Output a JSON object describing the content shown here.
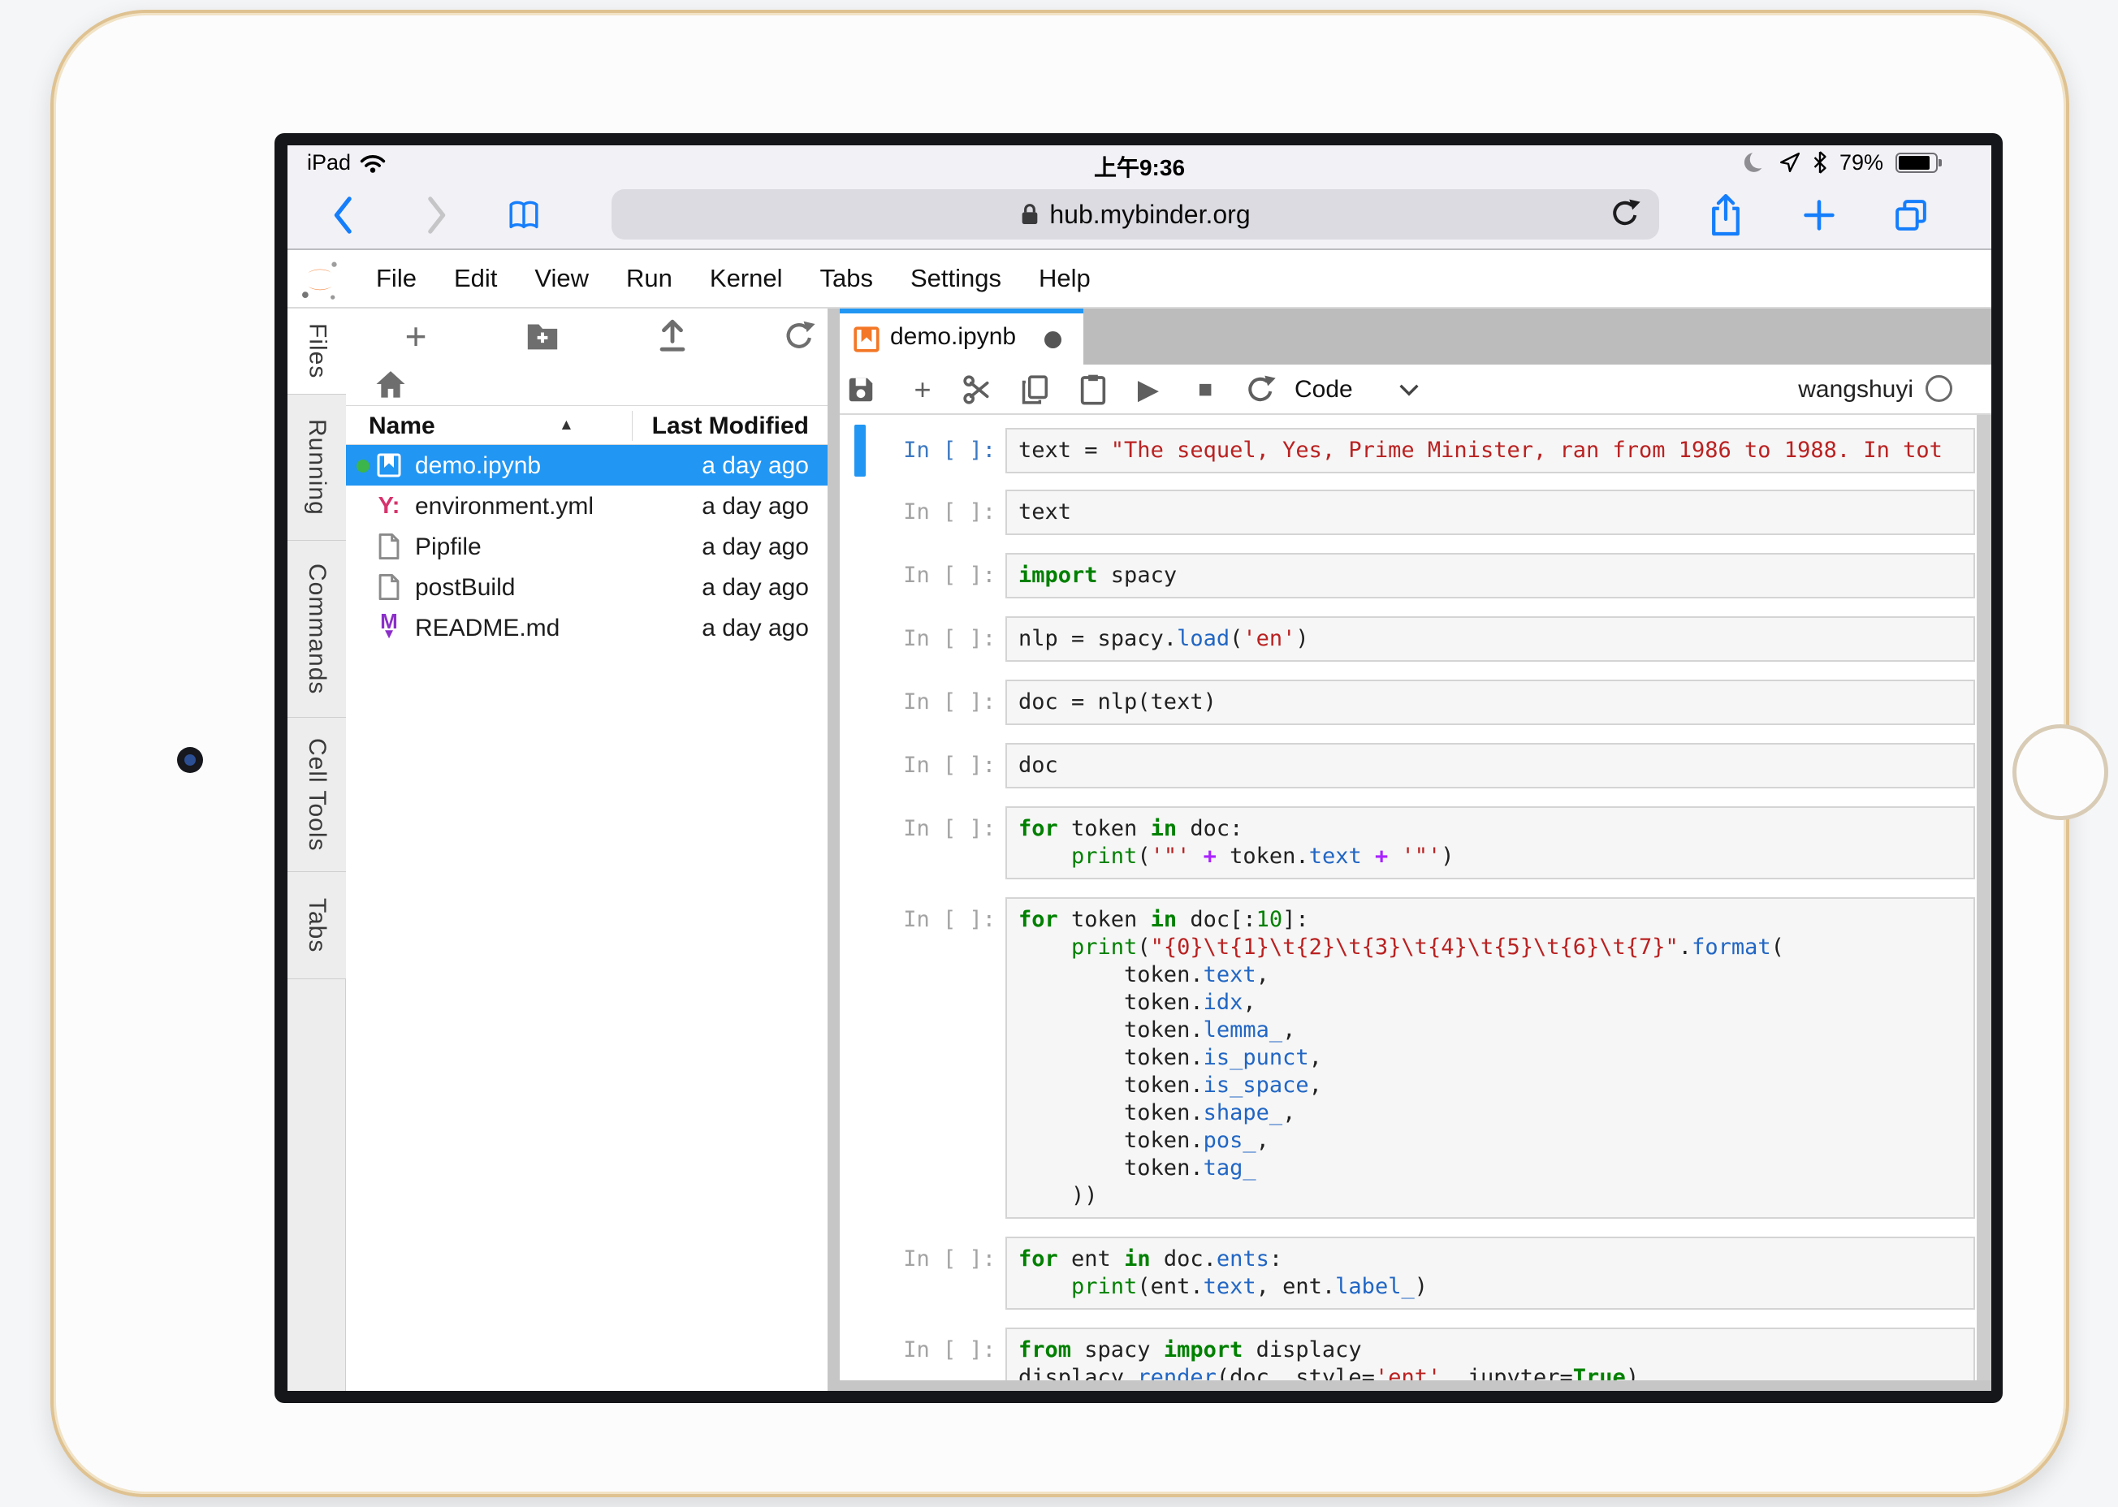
{
  "status_bar": {
    "carrier": "iPad",
    "time": "上午9:36",
    "battery_percent": "79%"
  },
  "browser": {
    "url": "hub.mybinder.org"
  },
  "jupyterlab": {
    "menu": [
      "File",
      "Edit",
      "View",
      "Run",
      "Kernel",
      "Tabs",
      "Settings",
      "Help"
    ],
    "sidebar_tabs": [
      {
        "label": "Files",
        "active": true
      },
      {
        "label": "Running",
        "active": false
      },
      {
        "label": "Commands",
        "active": false
      },
      {
        "label": "Cell Tools",
        "active": false
      },
      {
        "label": "Tabs",
        "active": false
      }
    ],
    "file_browser": {
      "columns": {
        "name": "Name",
        "modified": "Last Modified"
      },
      "files": [
        {
          "name": "demo.ipynb",
          "modified": "a day ago",
          "type": "notebook",
          "selected": true,
          "running": true
        },
        {
          "name": "environment.yml",
          "modified": "a day ago",
          "type": "yaml",
          "selected": false,
          "running": false
        },
        {
          "name": "Pipfile",
          "modified": "a day ago",
          "type": "file",
          "selected": false,
          "running": false
        },
        {
          "name": "postBuild",
          "modified": "a day ago",
          "type": "file",
          "selected": false,
          "running": false
        },
        {
          "name": "README.md",
          "modified": "a day ago",
          "type": "markdown",
          "selected": false,
          "running": false
        }
      ]
    },
    "notebook": {
      "tab_title": "demo.ipynb",
      "dirty": true,
      "mode": "Code",
      "kernel_user": "wangshuyi",
      "prompt": "In [ ]:",
      "cells": [
        {
          "selected": true,
          "lines": [
            [
              {
                "c": "pl",
                "t": "text = "
              },
              {
                "c": "str",
                "t": "\"The sequel, Yes, Prime Minister, ran from 1986 to 1988. In tot"
              }
            ]
          ]
        },
        {
          "selected": false,
          "lines": [
            [
              {
                "c": "pl",
                "t": "text"
              }
            ]
          ]
        },
        {
          "selected": false,
          "lines": [
            [
              {
                "c": "kw",
                "t": "import"
              },
              {
                "c": "pl",
                "t": " spacy"
              }
            ]
          ]
        },
        {
          "selected": false,
          "lines": [
            [
              {
                "c": "pl",
                "t": "nlp = spacy."
              },
              {
                "c": "prop",
                "t": "load"
              },
              {
                "c": "pl",
                "t": "("
              },
              {
                "c": "str",
                "t": "'en'"
              },
              {
                "c": "pl",
                "t": ")"
              }
            ]
          ]
        },
        {
          "selected": false,
          "lines": [
            [
              {
                "c": "pl",
                "t": "doc = nlp(text)"
              }
            ]
          ]
        },
        {
          "selected": false,
          "lines": [
            [
              {
                "c": "pl",
                "t": "doc"
              }
            ]
          ]
        },
        {
          "selected": false,
          "lines": [
            [
              {
                "c": "kw",
                "t": "for"
              },
              {
                "c": "pl",
                "t": " token "
              },
              {
                "c": "kw",
                "t": "in"
              },
              {
                "c": "pl",
                "t": " doc:"
              }
            ],
            [
              {
                "c": "pl",
                "t": "    "
              },
              {
                "c": "fn",
                "t": "print"
              },
              {
                "c": "pl",
                "t": "("
              },
              {
                "c": "str",
                "t": "'\"'"
              },
              {
                "c": "pl",
                "t": " "
              },
              {
                "c": "op",
                "t": "+"
              },
              {
                "c": "pl",
                "t": " token."
              },
              {
                "c": "prop",
                "t": "text"
              },
              {
                "c": "pl",
                "t": " "
              },
              {
                "c": "op",
                "t": "+"
              },
              {
                "c": "pl",
                "t": " "
              },
              {
                "c": "str",
                "t": "'\"'"
              },
              {
                "c": "pl",
                "t": ")"
              }
            ]
          ]
        },
        {
          "selected": false,
          "lines": [
            [
              {
                "c": "kw",
                "t": "for"
              },
              {
                "c": "pl",
                "t": " token "
              },
              {
                "c": "kw",
                "t": "in"
              },
              {
                "c": "pl",
                "t": " doc[:"
              },
              {
                "c": "num",
                "t": "10"
              },
              {
                "c": "pl",
                "t": "]:"
              }
            ],
            [
              {
                "c": "pl",
                "t": "    "
              },
              {
                "c": "fn",
                "t": "print"
              },
              {
                "c": "pl",
                "t": "("
              },
              {
                "c": "str",
                "t": "\"{0}\\t{1}\\t{2}\\t{3}\\t{4}\\t{5}\\t{6}\\t{7}\""
              },
              {
                "c": "pl",
                "t": "."
              },
              {
                "c": "prop",
                "t": "format"
              },
              {
                "c": "pl",
                "t": "("
              }
            ],
            [
              {
                "c": "pl",
                "t": "        token."
              },
              {
                "c": "prop",
                "t": "text"
              },
              {
                "c": "pl",
                "t": ","
              }
            ],
            [
              {
                "c": "pl",
                "t": "        token."
              },
              {
                "c": "prop",
                "t": "idx"
              },
              {
                "c": "pl",
                "t": ","
              }
            ],
            [
              {
                "c": "pl",
                "t": "        token."
              },
              {
                "c": "prop",
                "t": "lemma_"
              },
              {
                "c": "pl",
                "t": ","
              }
            ],
            [
              {
                "c": "pl",
                "t": "        token."
              },
              {
                "c": "prop",
                "t": "is_punct"
              },
              {
                "c": "pl",
                "t": ","
              }
            ],
            [
              {
                "c": "pl",
                "t": "        token."
              },
              {
                "c": "prop",
                "t": "is_space"
              },
              {
                "c": "pl",
                "t": ","
              }
            ],
            [
              {
                "c": "pl",
                "t": "        token."
              },
              {
                "c": "prop",
                "t": "shape_"
              },
              {
                "c": "pl",
                "t": ","
              }
            ],
            [
              {
                "c": "pl",
                "t": "        token."
              },
              {
                "c": "prop",
                "t": "pos_"
              },
              {
                "c": "pl",
                "t": ","
              }
            ],
            [
              {
                "c": "pl",
                "t": "        token."
              },
              {
                "c": "prop",
                "t": "tag_"
              }
            ],
            [
              {
                "c": "pl",
                "t": "    ))"
              }
            ]
          ]
        },
        {
          "selected": false,
          "lines": [
            [
              {
                "c": "kw",
                "t": "for"
              },
              {
                "c": "pl",
                "t": " ent "
              },
              {
                "c": "kw",
                "t": "in"
              },
              {
                "c": "pl",
                "t": " doc."
              },
              {
                "c": "prop",
                "t": "ents"
              },
              {
                "c": "pl",
                "t": ":"
              }
            ],
            [
              {
                "c": "pl",
                "t": "    "
              },
              {
                "c": "fn",
                "t": "print"
              },
              {
                "c": "pl",
                "t": "(ent."
              },
              {
                "c": "prop",
                "t": "text"
              },
              {
                "c": "pl",
                "t": ", ent."
              },
              {
                "c": "prop",
                "t": "label_"
              },
              {
                "c": "pl",
                "t": ")"
              }
            ]
          ]
        },
        {
          "selected": false,
          "lines": [
            [
              {
                "c": "kw",
                "t": "from"
              },
              {
                "c": "pl",
                "t": " spacy "
              },
              {
                "c": "kw",
                "t": "import"
              },
              {
                "c": "pl",
                "t": " displacy"
              }
            ],
            [
              {
                "c": "pl",
                "t": "displacy."
              },
              {
                "c": "prop",
                "t": "render"
              },
              {
                "c": "pl",
                "t": "(doc, style="
              },
              {
                "c": "str",
                "t": "'ent'"
              },
              {
                "c": "pl",
                "t": ", jupyter="
              },
              {
                "c": "kw",
                "t": "True"
              },
              {
                "c": "pl",
                "t": ")"
              }
            ]
          ]
        }
      ]
    }
  },
  "icons": {
    "run": "▶",
    "stop": "■",
    "sort_asc": "▲",
    "plus": "+"
  },
  "colors": {
    "selection_blue": "#2196f3",
    "safari_blue": "#157efb",
    "jupyter_orange": "#f37726",
    "running_green": "#3cb54a",
    "yaml_pink": "#d6336c",
    "markdown_purple": "#8b2fc9",
    "syntax": {
      "keyword": "#008000",
      "string": "#ba2121",
      "number": "#008000",
      "operator": "#aa22ff",
      "property": "#2166c4"
    }
  }
}
